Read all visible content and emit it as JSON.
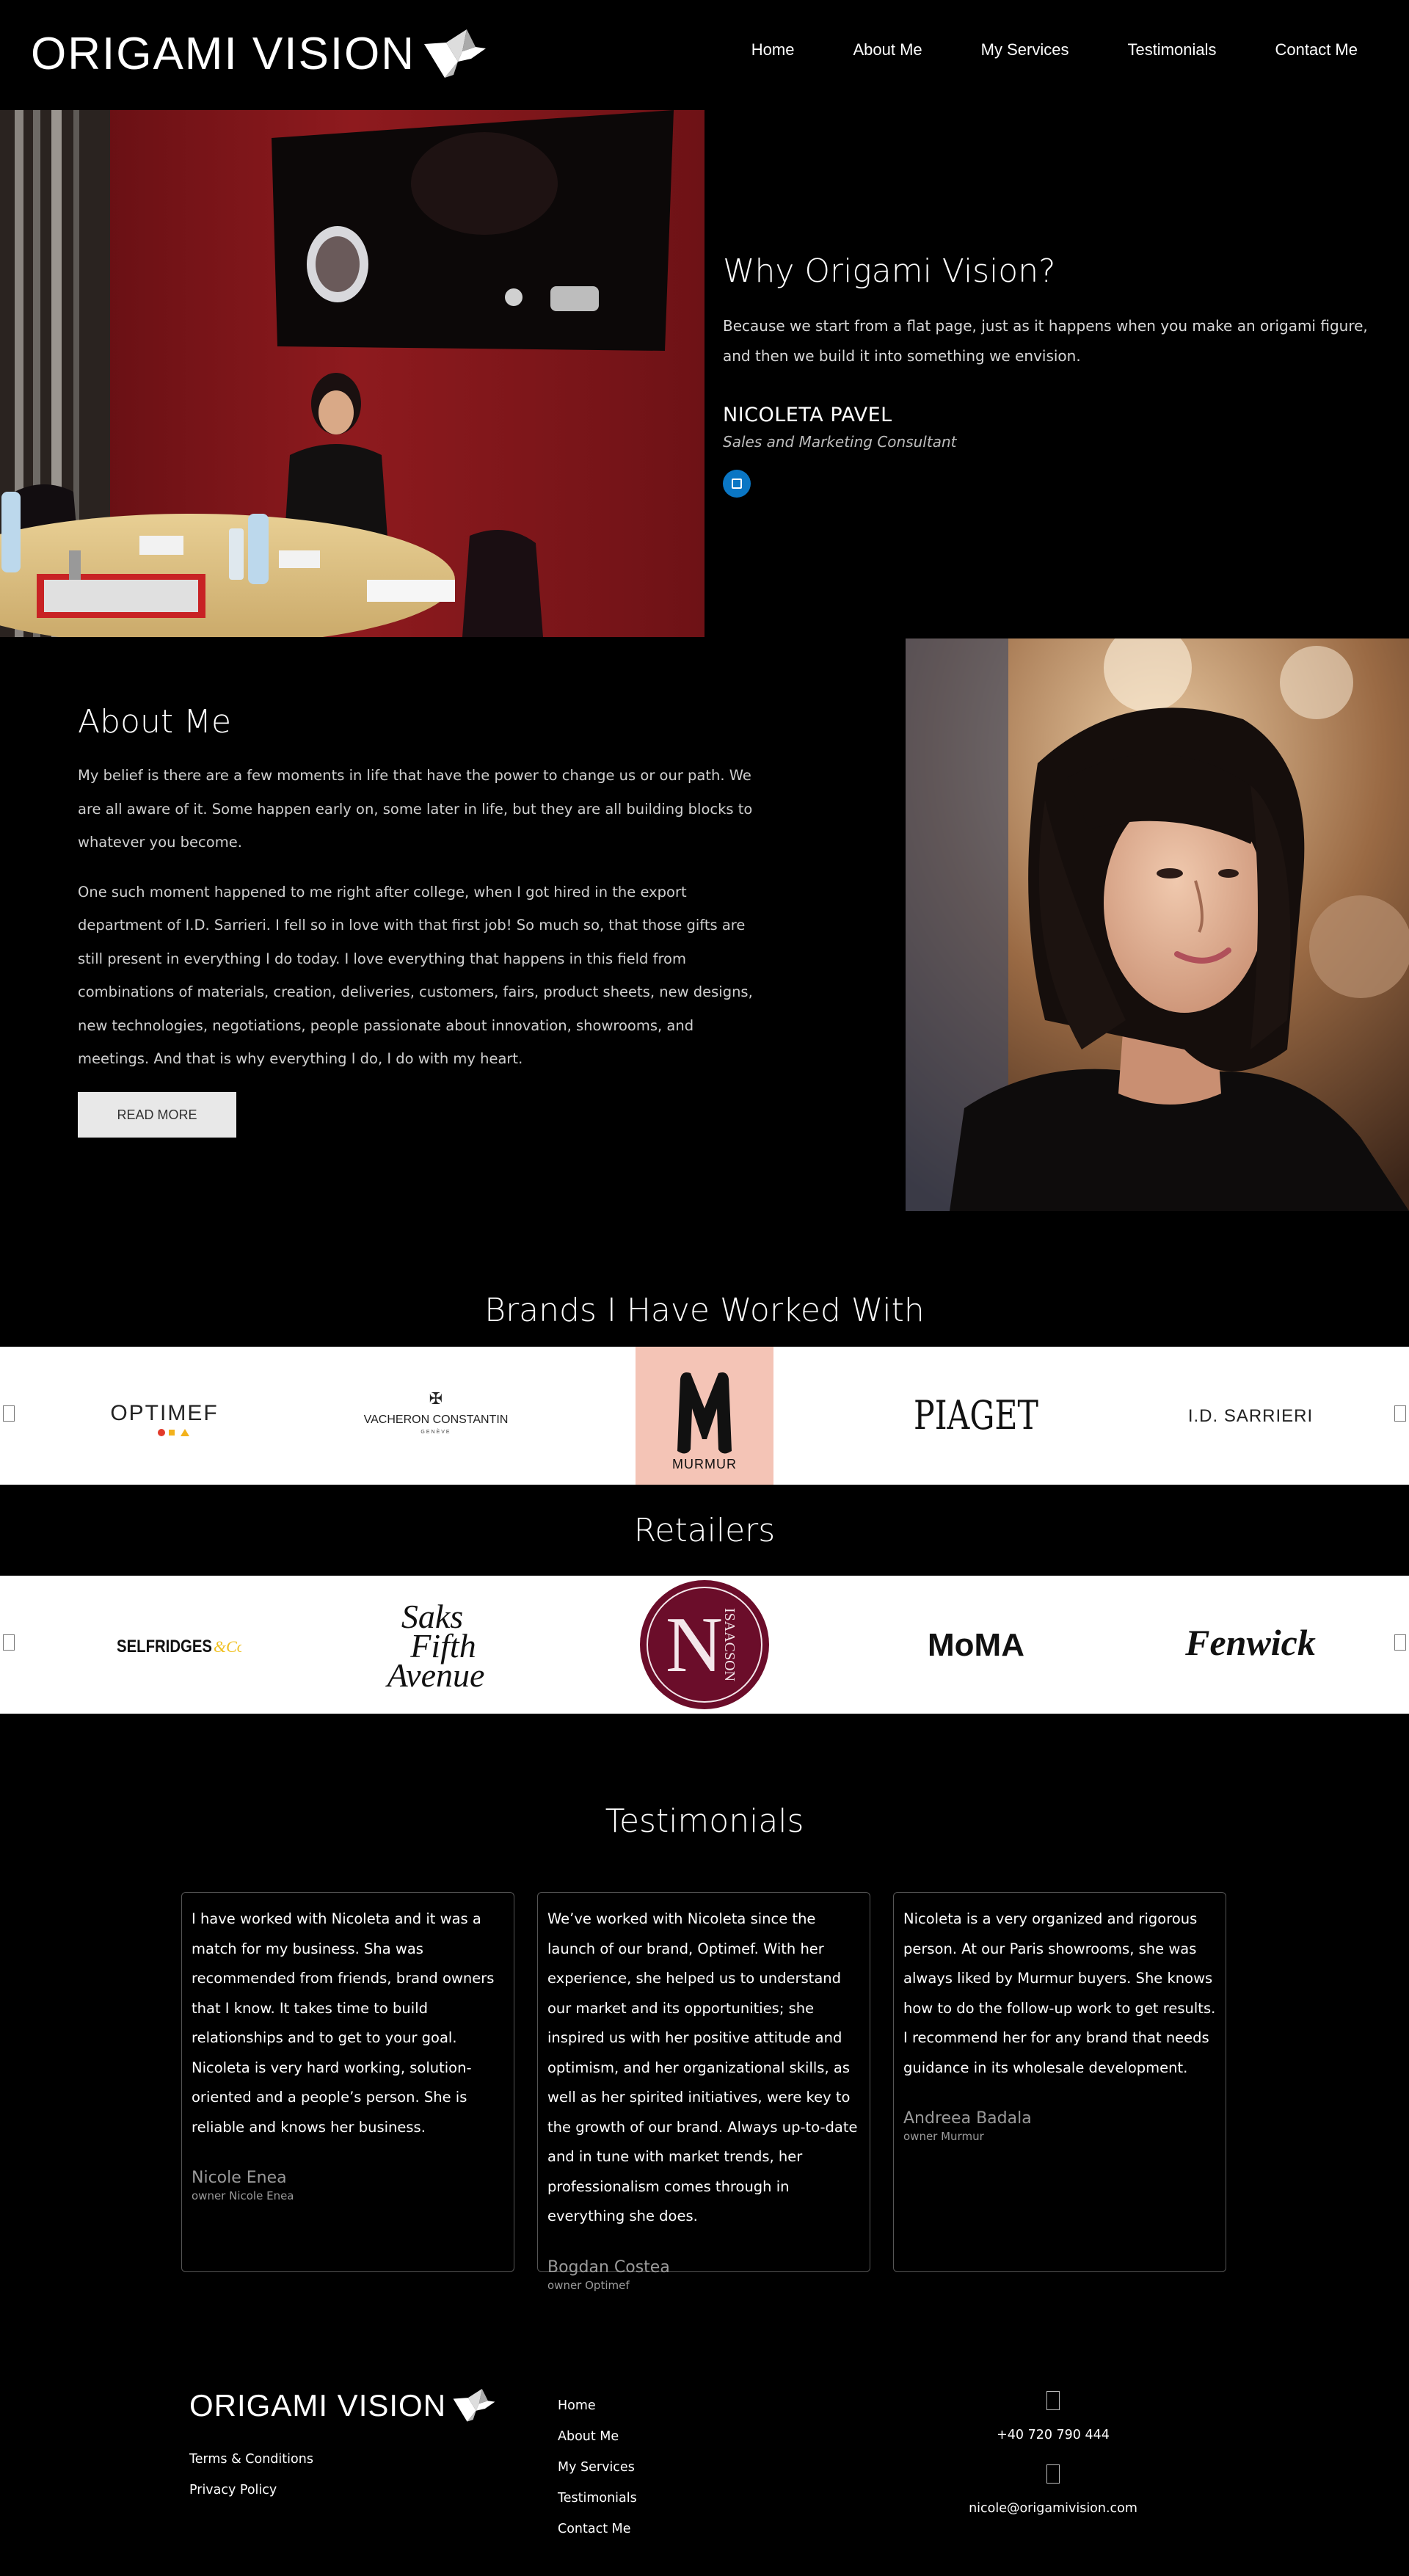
{
  "brand": {
    "logo_text": "ORIGAMI VISION"
  },
  "nav": [
    {
      "label": "Home"
    },
    {
      "label": "About Me"
    },
    {
      "label": "My Services"
    },
    {
      "label": "Testimonials"
    },
    {
      "label": "Contact Me"
    }
  ],
  "hero": {
    "title": "Why Origami Vision?",
    "description": "Because we start from a flat page, just as it happens when you make an origami figure, and then we build it into something we envision.",
    "name": "NICOLETA PAVEL",
    "role": "Sales and Marketing Consultant",
    "social_icon": "linkedin-icon"
  },
  "about": {
    "title": "About Me",
    "paragraphs": [
      "My belief is there are a few moments in life that have the power to change us or our path. We are all aware of it. Some happen early on, some later in life, but they are all building blocks to whatever you become.",
      "One such moment happened to me right after college, when I got hired in the export department of I.D. Sarrieri. I fell so in love with that first job! So much so, that those gifts are still present in everything I do today. I love everything that happens in this field from combinations of materials, creation, deliveries, customers, fairs, product sheets, new designs, new technologies, negotiations, people passionate about innovation, showrooms, and meetings. And that is why everything I do, I do with my heart."
    ],
    "button_label": "READ MORE"
  },
  "brands": {
    "title": "Brands I Have Worked With",
    "logos": [
      {
        "name": "OPTIMEF"
      },
      {
        "name": "VACHERON CONSTANTIN",
        "sub": "GENÈVE"
      },
      {
        "name": "MURMUR",
        "mark": "M",
        "bg": "#f4c4b6"
      },
      {
        "name": "PIAGET"
      },
      {
        "name": "I.D. SARRIERI"
      }
    ]
  },
  "retailers": {
    "title": "Retailers",
    "logos": [
      {
        "name": "SELFRIDGES",
        "suffix": "&Co"
      },
      {
        "lines": [
          "Saks",
          "Fifth",
          "Avenue"
        ]
      },
      {
        "mark": "N",
        "name": "ISAACSON",
        "bg": "#6b0d2a"
      },
      {
        "name": "MoMA"
      },
      {
        "name": "Fenwick"
      }
    ]
  },
  "testimonials": {
    "title": "Testimonials",
    "items": [
      {
        "quote": "I have worked with Nicoleta and it was a match for my business. Sha was recommended from friends, brand owners that I know. It takes time to build relationships and to get to your goal. Nicoleta is very hard working, solution-oriented and a people’s person. She is reliable and knows her business.",
        "author": "Nicole Enea",
        "role": "owner Nicole Enea"
      },
      {
        "quote": "We’ve worked with Nicoleta since the launch of our brand, Optimef. With her experience, she helped us to understand our market and its opportunities; she inspired us with her positive attitude and optimism, and her organizational skills, as well as her spirited initiatives, were key to the growth of our brand. Always up-to-date and in tune with market trends, her professionalism comes through in everything she does.",
        "author": "Bogdan Costea",
        "role": "owner Optimef"
      },
      {
        "quote": "Nicoleta is a very organized and rigorous person. At our Paris showrooms, she was always liked by Murmur buyers. She knows how to do the follow-up work to get results. I recommend her for any brand that needs guidance in its wholesale development.",
        "author": "Andreea Badala",
        "role": "owner Murmur"
      }
    ]
  },
  "footer": {
    "logo_text": "ORIGAMI VISION",
    "legal_links": [
      {
        "label": "Terms & Conditions"
      },
      {
        "label": "Privacy Policy"
      }
    ],
    "nav": [
      {
        "label": "Home"
      },
      {
        "label": "About Me"
      },
      {
        "label": "My Services"
      },
      {
        "label": "Testimonials"
      },
      {
        "label": "Contact Me"
      }
    ],
    "contact": {
      "phone_icon": "phone-icon",
      "phone": "+40 720 790 444",
      "email_icon": "email-icon",
      "email": "nicole@origamivision.com"
    }
  },
  "colors": {
    "background": "#000000",
    "card_border": "#555555",
    "linkedin_blue": "#0a76c4",
    "button_bg": "#e8e8e8"
  }
}
